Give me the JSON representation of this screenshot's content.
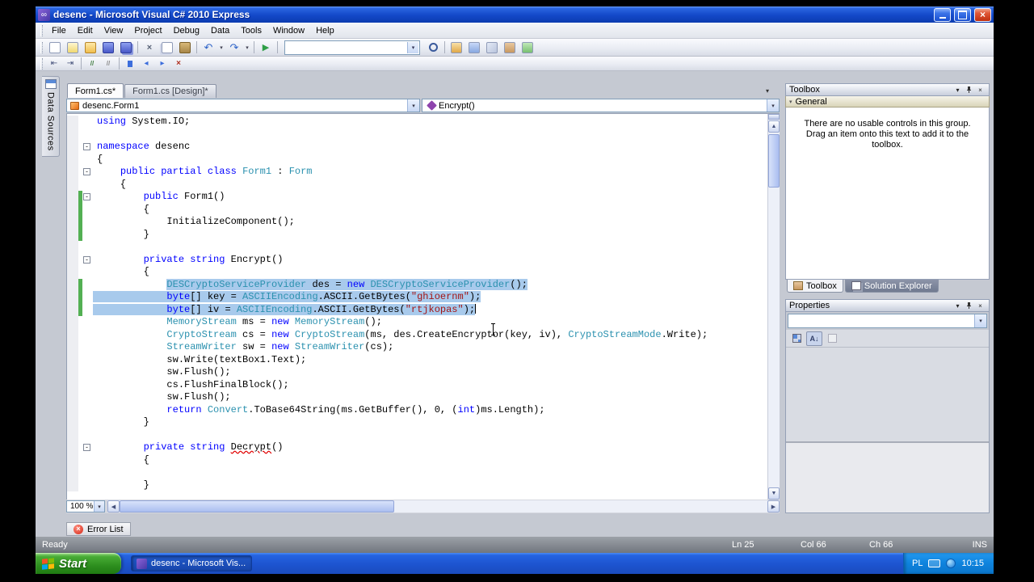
{
  "window": {
    "title": "desenc - Microsoft Visual C# 2010 Express"
  },
  "menu": {
    "items": [
      "File",
      "Edit",
      "View",
      "Project",
      "Debug",
      "Data",
      "Tools",
      "Window",
      "Help"
    ]
  },
  "toolbar_standard": {
    "items": [
      "new-project",
      "add-new-item",
      "open-file",
      "save",
      "save-all",
      "sep",
      "cut",
      "copy",
      "paste",
      "sep",
      "undo+dd",
      "redo+dd",
      "sep",
      "start-debugging",
      "sep",
      "combo",
      "find-in-files",
      "sep",
      "solution-explorer",
      "properties-window",
      "object-browser",
      "toolbox",
      "extension-manager"
    ],
    "combo_value": ""
  },
  "toolbar_text_editor": {
    "items": [
      "decrease-indent",
      "increase-indent",
      "sep",
      "comment-selection",
      "uncomment-selection",
      "sep",
      "toggle-bookmark",
      "previous-bookmark",
      "next-bookmark",
      "clear-bookmarks"
    ]
  },
  "left_strip": {
    "label": "Data Sources"
  },
  "document_tabs": [
    {
      "label": "Form1.cs*",
      "active": true
    },
    {
      "label": "Form1.cs [Design]*",
      "active": false
    }
  ],
  "nav": {
    "types": "desenc.Form1",
    "members": "Encrypt()"
  },
  "editor": {
    "zoom": "100 %",
    "lines": [
      {
        "tok": [
          [
            "k",
            "using"
          ],
          [
            "p",
            " System.IO;"
          ]
        ]
      },
      {
        "tok": []
      },
      {
        "fold": true,
        "tok": [
          [
            "k",
            "namespace"
          ],
          [
            "p",
            " desenc"
          ]
        ]
      },
      {
        "tok": [
          [
            "p",
            "{"
          ]
        ]
      },
      {
        "fold": true,
        "tok": [
          [
            "p",
            "    "
          ],
          [
            "k",
            "public"
          ],
          [
            "p",
            " "
          ],
          [
            "k",
            "partial"
          ],
          [
            "p",
            " "
          ],
          [
            "k",
            "class"
          ],
          [
            "p",
            " "
          ],
          [
            "t",
            "Form1"
          ],
          [
            "p",
            " : "
          ],
          [
            "t",
            "Form"
          ]
        ]
      },
      {
        "tok": [
          [
            "p",
            "    {"
          ]
        ]
      },
      {
        "fold": true,
        "green": true,
        "tok": [
          [
            "p",
            "        "
          ],
          [
            "k",
            "public"
          ],
          [
            "p",
            " Form1()"
          ]
        ]
      },
      {
        "green": true,
        "tok": [
          [
            "p",
            "        {"
          ]
        ]
      },
      {
        "green": true,
        "tok": [
          [
            "p",
            "            InitializeComponent();"
          ]
        ]
      },
      {
        "green": true,
        "tok": [
          [
            "p",
            "        }"
          ]
        ]
      },
      {
        "tok": []
      },
      {
        "fold": true,
        "tok": [
          [
            "p",
            "        "
          ],
          [
            "k",
            "private"
          ],
          [
            "p",
            " "
          ],
          [
            "k",
            "string"
          ],
          [
            "p",
            " Encrypt()"
          ]
        ]
      },
      {
        "tok": [
          [
            "p",
            "        {"
          ]
        ]
      },
      {
        "sel": "text",
        "green": true,
        "tok": [
          [
            "p",
            "            "
          ],
          [
            "t",
            "DESCryptoServiceProvider"
          ],
          [
            "p",
            " des = "
          ],
          [
            "k",
            "new"
          ],
          [
            "p",
            " "
          ],
          [
            "t",
            "DESCryptoServiceProvider"
          ],
          [
            "p",
            "();"
          ]
        ]
      },
      {
        "sel": "full",
        "green": true,
        "tok": [
          [
            "p",
            "            "
          ],
          [
            "k",
            "byte"
          ],
          [
            "p",
            "[] key = "
          ],
          [
            "t",
            "ASCIIEncoding"
          ],
          [
            "p",
            ".ASCII.GetBytes("
          ],
          [
            "s",
            "\"ghioernm\""
          ],
          [
            "p",
            ");"
          ]
        ]
      },
      {
        "sel": "full",
        "green": true,
        "caret": true,
        "tok": [
          [
            "p",
            "            "
          ],
          [
            "k",
            "byte"
          ],
          [
            "p",
            "[] iv = "
          ],
          [
            "t",
            "ASCIIEncoding"
          ],
          [
            "p",
            ".ASCII.GetBytes("
          ],
          [
            "s",
            "\"rtjkopas\""
          ],
          [
            "p",
            ");"
          ]
        ]
      },
      {
        "tok": [
          [
            "p",
            "            "
          ],
          [
            "t",
            "MemoryStream"
          ],
          [
            "p",
            " ms = "
          ],
          [
            "k",
            "new"
          ],
          [
            "p",
            " "
          ],
          [
            "t",
            "MemoryStream"
          ],
          [
            "p",
            "();"
          ]
        ]
      },
      {
        "tok": [
          [
            "p",
            "            "
          ],
          [
            "t",
            "CryptoStream"
          ],
          [
            "p",
            " cs = "
          ],
          [
            "k",
            "new"
          ],
          [
            "p",
            " "
          ],
          [
            "t",
            "CryptoStream"
          ],
          [
            "p",
            "(ms, des.CreateEncryptor(key, iv), "
          ],
          [
            "t",
            "CryptoStreamMode"
          ],
          [
            "p",
            ".Write);"
          ]
        ]
      },
      {
        "tok": [
          [
            "p",
            "            "
          ],
          [
            "t",
            "StreamWriter"
          ],
          [
            "p",
            " sw = "
          ],
          [
            "k",
            "new"
          ],
          [
            "p",
            " "
          ],
          [
            "t",
            "StreamWriter"
          ],
          [
            "p",
            "(cs);"
          ]
        ]
      },
      {
        "tok": [
          [
            "p",
            "            sw.Write(textBox1.Text);"
          ]
        ]
      },
      {
        "tok": [
          [
            "p",
            "            sw.Flush();"
          ]
        ]
      },
      {
        "tok": [
          [
            "p",
            "            cs.FlushFinalBlock();"
          ]
        ]
      },
      {
        "tok": [
          [
            "p",
            "            sw.Flush();"
          ]
        ]
      },
      {
        "tok": [
          [
            "p",
            "            "
          ],
          [
            "k",
            "return"
          ],
          [
            "p",
            " "
          ],
          [
            "t",
            "Convert"
          ],
          [
            "p",
            ".ToBase64String(ms.GetBuffer(), 0, ("
          ],
          [
            "k",
            "int"
          ],
          [
            "p",
            ")ms.Length);"
          ]
        ]
      },
      {
        "tok": [
          [
            "p",
            "        }"
          ]
        ]
      },
      {
        "tok": []
      },
      {
        "fold": true,
        "tok": [
          [
            "p",
            "        "
          ],
          [
            "k",
            "private"
          ],
          [
            "p",
            " "
          ],
          [
            "k",
            "string"
          ],
          [
            "p",
            " "
          ],
          [
            "e",
            "Decrypt"
          ],
          [
            "p",
            "()"
          ]
        ]
      },
      {
        "tok": [
          [
            "p",
            "        {"
          ]
        ]
      },
      {
        "tok": []
      },
      {
        "tok": [
          [
            "p",
            "        }"
          ]
        ]
      }
    ]
  },
  "toolbox": {
    "title": "Toolbox",
    "group": "General",
    "empty_text": "There are no usable controls in this group. Drag an item onto this text to add it to the toolbox."
  },
  "panel_tabs": [
    {
      "label": "Toolbox",
      "icon": "toolbox-icon",
      "active": true
    },
    {
      "label": "Solution Explorer",
      "icon": "solution-explorer-icon",
      "active": false
    }
  ],
  "properties": {
    "title": "Properties",
    "combo_value": "",
    "toolbar": [
      "categorized",
      "alphabetical",
      "property-pages"
    ]
  },
  "error_list": {
    "label": "Error List"
  },
  "status": {
    "ready": "Ready",
    "ln": "Ln 25",
    "col": "Col 66",
    "ch": "Ch 66",
    "ins": "INS"
  },
  "taskbar": {
    "start_label": "Start",
    "task_label": "desenc - Microsoft Vis...",
    "tray_language": "PL",
    "clock": "10:15"
  },
  "colors": {
    "title_bar_blue": "#1A50D0",
    "selection_blue": "#A8CAEC",
    "keyword_blue": "#0000FF",
    "user_type_teal": "#2B91AF",
    "string_red": "#A31515",
    "change_bar_green": "#53B053",
    "start_button_green": "#2E8F1F",
    "taskbar_blue": "#1D54D0"
  }
}
